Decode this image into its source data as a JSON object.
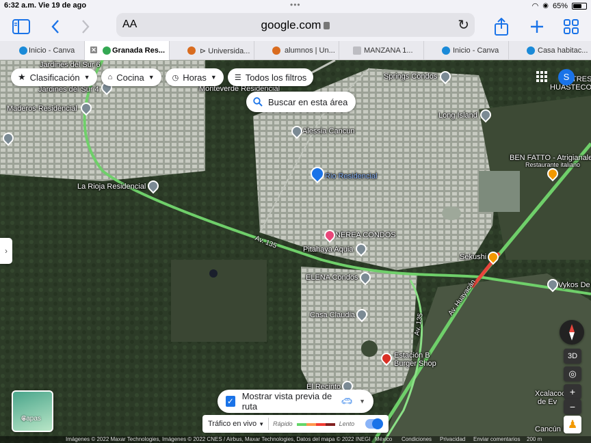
{
  "status": {
    "time": "6:32 a.m.",
    "date": "Vie 19 de ago",
    "battery": "65%",
    "battery_level": 0.65
  },
  "browser": {
    "aa": "AA",
    "url": "google.com"
  },
  "tabs": [
    {
      "label": "Inicio - Canva",
      "color": "#1a8ad8"
    },
    {
      "label": "Granada Res...",
      "color": "#34a853"
    },
    {
      "label": "⊳ Universida...",
      "color": "#d96c1f"
    },
    {
      "label": "alumnos | Un...",
      "color": "#d96c1f"
    },
    {
      "label": "MANZANA 1...",
      "color": "#bdbdc2"
    },
    {
      "label": "Inicio - Canva",
      "color": "#1a8ad8"
    },
    {
      "label": "Casa habitac...",
      "color": "#1a8ad8"
    }
  ],
  "filters": {
    "rating": "Clasificación",
    "cuisine": "Cocina",
    "hours": "Horas",
    "all": "Todos los filtros"
  },
  "search_area": "Buscar en esta área",
  "labels": {
    "jardines6": "Jardines del Sur 6",
    "jardines4": "Jardines del Sur 4",
    "monteverde": "Monteverde Residencial",
    "maderos": "Maderos Residencial",
    "springs": "Springs Condos",
    "alessia": "Alessia Cancun",
    "long_island": "Long Island",
    "rio": "Rio Residencial",
    "larioja": "La Rioja Residencial",
    "benfatto": "BEN FATTO - Atrigianale",
    "benfatto_sub": "Restaurante italiano",
    "nerea": "NEREA CONDOS",
    "pitahaya": "Pitahaya Aquia",
    "av135": "Av. 135",
    "av135b": "Av. 135",
    "sekushi": "Sekushi",
    "elena": "ELENA Condos",
    "casa_claudia": "Casa Claudia",
    "huayacan": "Av. Huayacán",
    "vykos": "Vykos De",
    "estacion": "Estación B",
    "estacion2": "Burger Shop",
    "recinto": "El Recinto",
    "xcalacoco": "Xcalacoco",
    "xcalacoco2": "de Ev",
    "cancun": "Cancún L",
    "huastecos": "TRES",
    "huastecos2": "HUASTECOS"
  },
  "route_preview": "Mostrar vista previa de ruta",
  "traffic": {
    "label": "Tráfico en vivo",
    "fast": "Rápido",
    "slow": "Lento"
  },
  "layers": "Capas",
  "avatar": "S",
  "footer": {
    "imagery": "Imágenes © 2022 Maxar Technologies, Imágenes © 2022 CNES / Airbus, Maxar Technologies, Datos del mapa © 2022 INEGI",
    "country": "México",
    "terms": "Condiciones",
    "privacy": "Privacidad",
    "feedback": "Enviar comentarios",
    "scale": "200 m"
  },
  "controls": {
    "three_d": "3D",
    "zoom_in": "+",
    "zoom_out": "−"
  }
}
